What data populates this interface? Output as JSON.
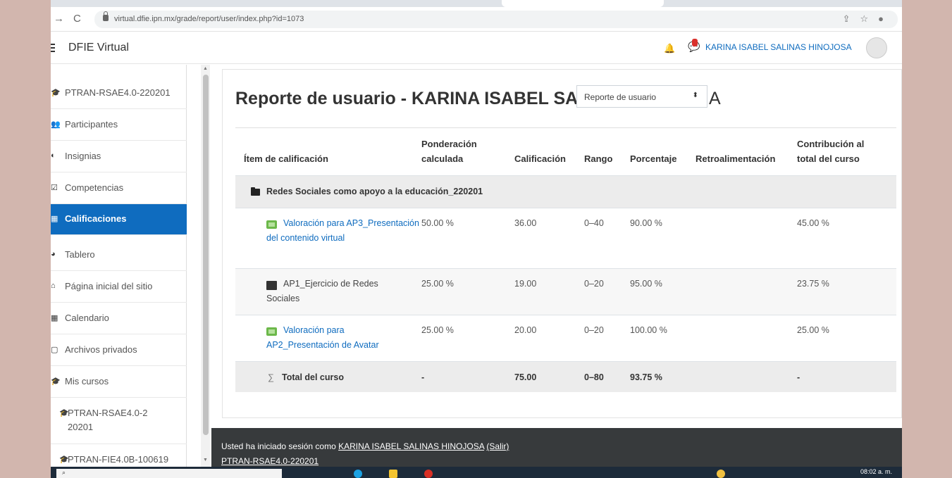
{
  "browser": {
    "url": "virtual.dfie.ipn.mx/grade/report/user/index.php?id=1073",
    "back": "→",
    "reload": "C",
    "share_icon": "share-icon",
    "star_icon": "star-icon"
  },
  "navbar": {
    "brand": "DFIE Virtual",
    "username": "KARINA ISABEL SALINAS HINOJOSA"
  },
  "sidebar": {
    "items": [
      {
        "label": "PTRAN-RSAE4.0-220201",
        "icon": "🎓"
      },
      {
        "label": "Participantes",
        "icon": "👥"
      },
      {
        "label": "Insignias",
        "icon": "◐"
      },
      {
        "label": "Competencias",
        "icon": "☑"
      },
      {
        "label": "Calificaciones",
        "icon": "▦"
      },
      {
        "label": "Tablero",
        "icon": "◕"
      },
      {
        "label": "Página inicial del sitio",
        "icon": "⌂"
      },
      {
        "label": "Calendario",
        "icon": "▦"
      },
      {
        "label": "Archivos privados",
        "icon": "▢"
      },
      {
        "label": "Mis cursos",
        "icon": "🎓"
      },
      {
        "label": "PTRAN-RSAE4.0-220201",
        "icon": "🎓"
      },
      {
        "label": "PTRAN-FIE4.0B-100619",
        "icon": "🎓"
      }
    ]
  },
  "main": {
    "title": "Reporte de usuario - KARINA ISABEL SAL",
    "title_tail": "A",
    "report_select": "Reporte de usuario",
    "headers": {
      "item": "Ítem de calificación",
      "weight": "Ponderación calculada",
      "grade": "Calificación",
      "range": "Rango",
      "percent": "Porcentaje",
      "feedback": "Retroalimentación",
      "contribution": "Contribución al total del curso"
    },
    "category": "Redes Sociales como apoyo a la educación_220201",
    "rows": [
      {
        "name": "Valoración para AP3_Presentación del contenido virtual",
        "weight": "50.00 %",
        "grade": "36.00",
        "range": "0–40",
        "percent": "90.00 %",
        "contribution": "45.00 %"
      },
      {
        "name": "AP1_Ejercicio de Redes Sociales",
        "weight": "25.00 %",
        "grade": "19.00",
        "range": "0–20",
        "percent": "95.00 %",
        "contribution": "23.75 %"
      },
      {
        "name": "Valoración para AP2_Presentación de Avatar",
        "weight": "25.00 %",
        "grade": "20.00",
        "range": "0–20",
        "percent": "100.00 %",
        "contribution": "25.00 %"
      }
    ],
    "total": {
      "name": "Total del curso",
      "weight": "-",
      "grade": "75.00",
      "range": "0–80",
      "percent": "93.75 %",
      "contribution": "-"
    }
  },
  "footer": {
    "prefix": "Usted ha iniciado sesión como",
    "user": "KARINA ISABEL SALINAS HINOJOSA",
    "logout": "(Salir)",
    "course": "PTRAN-RSAE4.0-220201"
  },
  "taskbar": {
    "time": "08:02 a. m."
  }
}
